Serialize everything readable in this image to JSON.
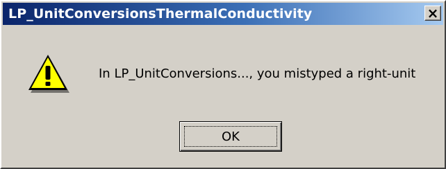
{
  "window": {
    "title": "LP_UnitConversionsThermalConductivity",
    "close_label": "×"
  },
  "dialog": {
    "icon": "warning-icon",
    "message": "In LP_UnitConversions..., you mistyped a right-unit",
    "ok_label": "OK"
  },
  "colors": {
    "titlebar_start": "#0a246a",
    "titlebar_end": "#a6caf0",
    "dialog_bg": "#d4d0c8",
    "warning_yellow": "#ffff00"
  }
}
